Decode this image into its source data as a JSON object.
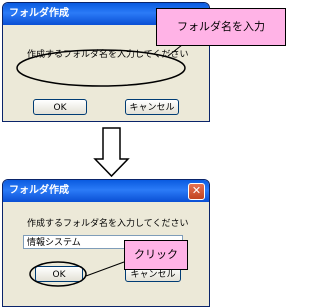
{
  "dialog_top": {
    "title": "フォルダ作成",
    "prompt": "作成するフォルダ名を入力してください",
    "input_value": "",
    "ok_label": "OK",
    "cancel_label": "キャンセル"
  },
  "dialog_bottom": {
    "title": "フォルダ作成",
    "close_symbol": "✕",
    "prompt": "作成するフォルダ名を入力してください",
    "input_value": "情報システム",
    "ok_label": "OK",
    "cancel_label": "キャンセル"
  },
  "callouts": {
    "input_note": "フォルダ名を入力",
    "click_note": "クリック"
  },
  "colors": {
    "callout_fill": "#ffb3e6",
    "dialog_face": "#ece9d8",
    "titlebar": "#0a5be0"
  }
}
